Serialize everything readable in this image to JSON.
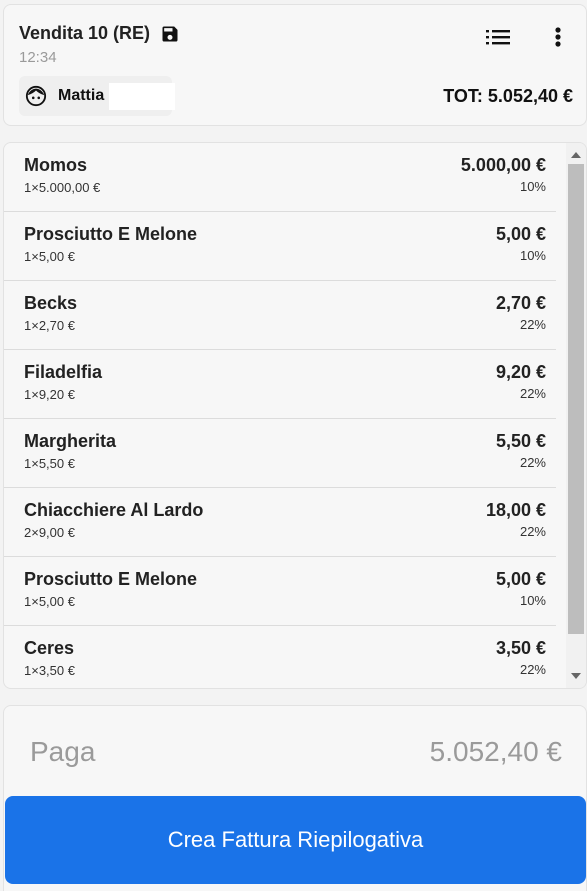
{
  "header": {
    "title": "Vendita 10 (RE)",
    "time": "12:34",
    "user": "Mattia",
    "total_label": "TOT: 5.052,40 €",
    "icons": {
      "save": "save-icon",
      "list": "list-icon",
      "more": "more-vert-icon",
      "user": "face-icon"
    }
  },
  "items": [
    {
      "name": "Momos",
      "qty": "1×5.000,00 €",
      "amount": "5.000,00 €",
      "vat": "10%"
    },
    {
      "name": "Prosciutto E Melone",
      "qty": "1×5,00 €",
      "amount": "5,00 €",
      "vat": "10%"
    },
    {
      "name": "Becks",
      "qty": "1×2,70 €",
      "amount": "2,70 €",
      "vat": "22%"
    },
    {
      "name": "Filadelfia",
      "qty": "1×9,20 €",
      "amount": "9,20 €",
      "vat": "22%"
    },
    {
      "name": "Margherita",
      "qty": "1×5,50 €",
      "amount": "5,50 €",
      "vat": "22%"
    },
    {
      "name": "Chiacchiere Al Lardo",
      "qty": "2×9,00 €",
      "amount": "18,00 €",
      "vat": "22%"
    },
    {
      "name": "Prosciutto E Melone",
      "qty": "1×5,00 €",
      "amount": "5,00 €",
      "vat": "10%"
    },
    {
      "name": "Ceres",
      "qty": "1×3,50 €",
      "amount": "3,50 €",
      "vat": "22%"
    }
  ],
  "pay": {
    "label": "Paga",
    "amount": "5.052,40 €"
  },
  "cta": {
    "label": "Crea Fattura Riepilogativa"
  },
  "colors": {
    "accent": "#1a73e8",
    "background": "#f3f3f3",
    "card": "#f7f7f7"
  }
}
